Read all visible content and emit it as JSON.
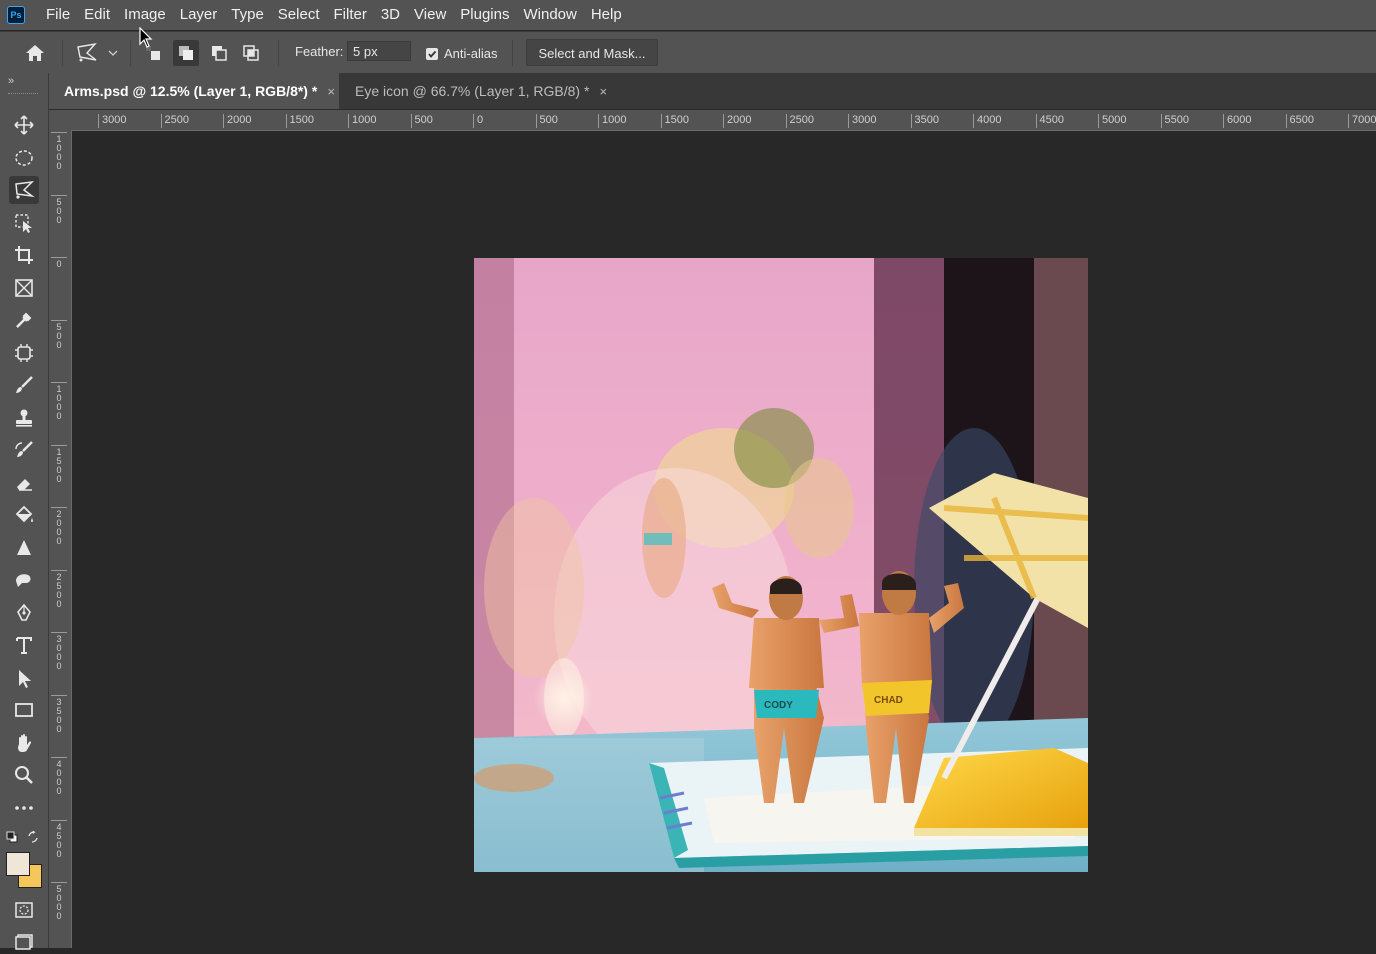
{
  "app": {
    "logo": "Ps"
  },
  "menu": [
    "File",
    "Edit",
    "Image",
    "Layer",
    "Type",
    "Select",
    "Filter",
    "3D",
    "View",
    "Plugins",
    "Window",
    "Help"
  ],
  "options": {
    "feather_label": "Feather:",
    "feather_value": "5 px",
    "antialias_label": "Anti-alias",
    "antialias_checked": true,
    "select_mask_label": "Select and Mask..."
  },
  "tabs": [
    {
      "label": "Arms.psd @ 12.5% (Layer 1, RGB/8*) *",
      "close": "×",
      "active": true
    },
    {
      "label": "Eye icon @ 66.7% (Layer 1, RGB/8) *",
      "close": "×",
      "active": false
    }
  ],
  "rulers": {
    "horizontal": [
      "3000",
      "2500",
      "2000",
      "1500",
      "1000",
      "500",
      "0",
      "500",
      "1000",
      "1500",
      "2000",
      "2500",
      "3000",
      "3500",
      "4000",
      "4500",
      "5000",
      "5500",
      "6000",
      "6500",
      "7000"
    ],
    "vertical": [
      "1000",
      "500",
      "0",
      "500",
      "1000",
      "1500",
      "2000",
      "2500",
      "3000",
      "3500",
      "4000",
      "4500",
      "5000"
    ]
  },
  "tools": [
    "move-icon",
    "marquee-icon",
    "polygonal-lasso-icon",
    "object-selection-icon",
    "crop-icon",
    "frame-icon",
    "eyedropper-icon",
    "patch-icon",
    "brush-icon",
    "stamp-icon",
    "history-brush-icon",
    "eraser-icon",
    "paint-bucket-icon",
    "sharpen-icon",
    "dodge-icon",
    "pen-icon",
    "type-icon",
    "path-select-icon",
    "rectangle-icon",
    "hand-icon",
    "zoom-icon",
    "more-tools-icon"
  ],
  "colors": {
    "foreground": "#efe6d8",
    "background": "#f5c65a",
    "ui_bg": "#535353",
    "canvas_bg": "#282828"
  },
  "photo": {
    "label_left": "CODY",
    "label_right": "CHAD"
  }
}
